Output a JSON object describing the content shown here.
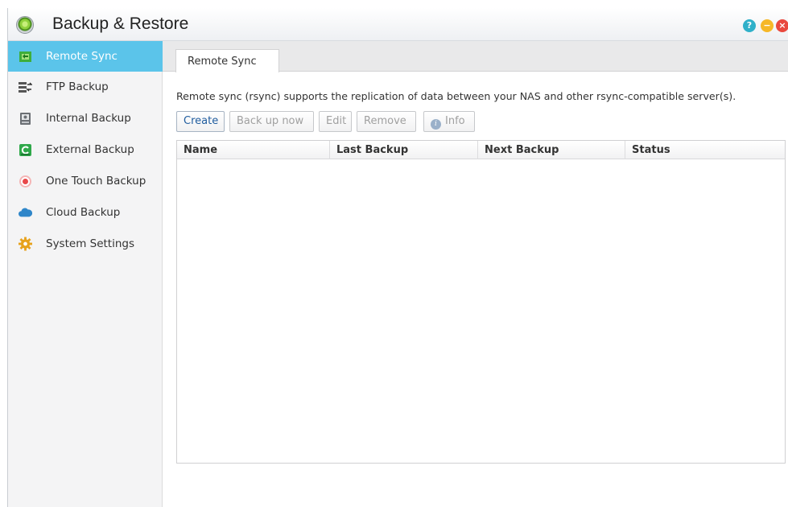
{
  "window": {
    "title": "Backup & Restore",
    "controls": {
      "help": "?",
      "minimize": "−",
      "close": "×"
    }
  },
  "sidebar": {
    "items": [
      {
        "label": "Remote Sync",
        "icon": "remote-sync-icon",
        "active": true
      },
      {
        "label": "FTP Backup",
        "icon": "ftp-backup-icon",
        "active": false
      },
      {
        "label": "Internal Backup",
        "icon": "internal-backup-icon",
        "active": false
      },
      {
        "label": "External Backup",
        "icon": "external-backup-icon",
        "active": false
      },
      {
        "label": "One Touch Backup",
        "icon": "one-touch-backup-icon",
        "active": false
      },
      {
        "label": "Cloud Backup",
        "icon": "cloud-icon",
        "active": false
      },
      {
        "label": "System Settings",
        "icon": "gear-icon",
        "active": false
      }
    ]
  },
  "main": {
    "tabs": [
      {
        "label": "Remote Sync",
        "active": true
      }
    ],
    "description": "Remote sync (rsync) supports the replication of data between your NAS and other rsync-compatible server(s).",
    "toolbar": {
      "create": "Create",
      "backup_now": "Back up now",
      "edit": "Edit",
      "remove": "Remove",
      "info": "Info"
    },
    "table": {
      "columns": [
        "Name",
        "Last Backup",
        "Next Backup",
        "Status"
      ],
      "rows": []
    }
  },
  "colors": {
    "accent": "#5bc4ea",
    "help": "#2fb0c9",
    "minimize": "#f6b828",
    "close": "#e9483e"
  }
}
